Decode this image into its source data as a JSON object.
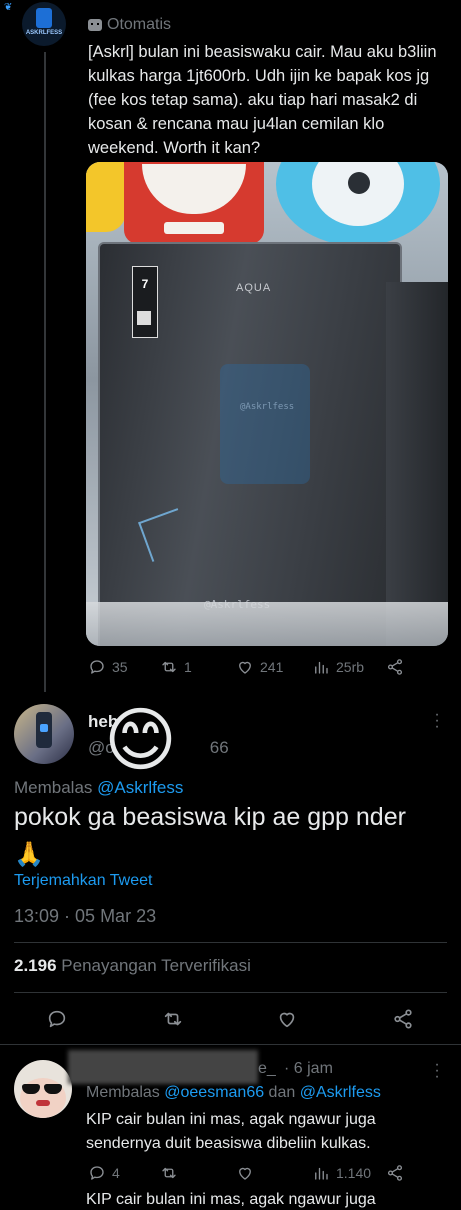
{
  "tweet1": {
    "avatar_text": "ASKRLFESS",
    "label": "Otomatis",
    "body": "[Askrl] bulan ini beasiswaku cair. Mau aku b3liin kulkas harga 1jt600rb. Udh ijin ke bapak kos jg (fee kos tetap sama). aku tiap hari masak2 di kosan & rencana mau ju4lan cemilan klo weekend. Worth it kan?",
    "image": {
      "watermark_center": "@Askrlfess",
      "watermark_bottom": "@Askrlfess",
      "fridge_brand": "AQUA",
      "energy_label_number": "7"
    },
    "actions": {
      "replies": "35",
      "retweets": "1",
      "likes": "241",
      "views": "25rb"
    }
  },
  "tweet2": {
    "name_fragment": "heb",
    "handle_fragment": "@c",
    "handle_tail": "66",
    "emoji": "😊",
    "reply_prefix": "Membalas ",
    "reply_to": "@Askrlfess",
    "body": "pokok ga beasiswa kip ae gpp nder",
    "body_emoji": "🙏",
    "translate": "Terjemahkan Tweet",
    "time": "13:09 · 05 Mar 23",
    "views_count": "2.196",
    "views_label": "Penayangan Terverifikasi"
  },
  "tweet3": {
    "handle_tail": "e_",
    "time": "· 6 jam",
    "reply_prefix": "Membalas ",
    "reply_to_1": "@oeesman66",
    "reply_and": " dan ",
    "reply_to_2": "@Askrlfess",
    "body": "KIP cair bulan ini mas, agak ngawur juga sendernya duit beasiswa dibeliin kulkas.",
    "actions": {
      "replies": "4",
      "views": "1.140"
    },
    "cutoff": "KIP cair bulan ini mas, agak ngawur juga"
  }
}
